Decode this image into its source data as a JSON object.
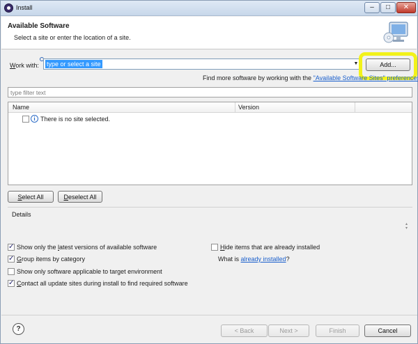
{
  "window": {
    "title": "Install"
  },
  "banner": {
    "heading": "Available Software",
    "subheading": "Select a site or enter the location of a site.",
    "icon": "monitor-install-icon"
  },
  "work_with": {
    "label_pre": "",
    "label_ul": "W",
    "label_post": "ork with:",
    "placeholder_value": "type or select a site",
    "add_button": "Add...",
    "find_more_text": "Find more software by working with the ",
    "find_more_link": "\"Available Software Sites\" preferences."
  },
  "filter": {
    "placeholder": "type filter text"
  },
  "table": {
    "columns": [
      "Name",
      "Version"
    ],
    "rows": [
      {
        "text": "There is no site selected.",
        "icon": "info-icon",
        "checked": false
      }
    ]
  },
  "selection_buttons": {
    "select_all_ul": "S",
    "select_all_rest": "elect All",
    "deselect_all_ul": "D",
    "deselect_all_rest": "eselect All"
  },
  "details": {
    "label": "Details"
  },
  "options": {
    "latest_pre": "Show only the ",
    "latest_ul": "l",
    "latest_post": "atest versions of available software",
    "latest_checked": true,
    "group_ul": "G",
    "group_post": "roup items by category",
    "group_checked": true,
    "applicable": "Show only software applicable to target environment",
    "applicable_checked": false,
    "contact_ul": "C",
    "contact_post": "ontact all update sites during install to find required software",
    "contact_checked": true,
    "hide_ul": "H",
    "hide_post": "ide items that are already installed",
    "hide_checked": false,
    "what_is_text": "What is ",
    "what_is_link": "already installed",
    "what_is_suffix": "?"
  },
  "footer": {
    "back": "< Back",
    "back_ul": "B",
    "next": "Next >",
    "next_ul": "N",
    "finish": "Finish",
    "finish_ul": "F",
    "cancel": "Cancel"
  }
}
